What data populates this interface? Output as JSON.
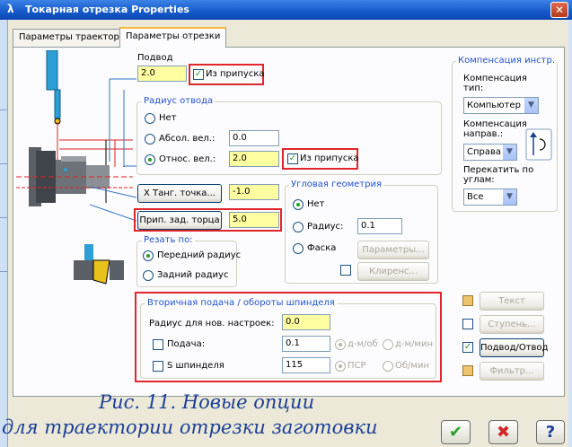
{
  "window": {
    "title": "Токарная отрезка Properties",
    "title_icon": "lambda-icon",
    "close_glyph": "✕"
  },
  "tabs": [
    {
      "label": "Параметры траектории",
      "active": false
    },
    {
      "label": "Параметры отрезки",
      "active": true
    }
  ],
  "approach": {
    "label": "Подвод",
    "value": "2.0",
    "from_stock_label": "Из припуска",
    "from_stock_checked": true
  },
  "retract": {
    "group_label": "Радиус отвода",
    "options": [
      "Нет",
      "Абсол. вел.:",
      "Относ. вел.:"
    ],
    "selected_index": 2,
    "abs_value": "0.0",
    "rel_value": "2.0",
    "from_stock_label": "Из припуска",
    "from_stock_checked": true
  },
  "x_tangent": {
    "button_label": "X Танг. точка...",
    "value": "-1.0"
  },
  "back_face": {
    "button_label": "Прип. зад. торца",
    "value": "5.0"
  },
  "cut_by": {
    "group_label": "Резать по:",
    "options": [
      "Передний радиус",
      "Задний радиус"
    ],
    "selected_index": 0
  },
  "angular": {
    "group_label": "Угловая геометрия",
    "options": [
      "Нет",
      "Радиус:",
      "Фаска"
    ],
    "selected_index": 0,
    "radius_value": "0.1",
    "params_button": "Параметры...",
    "clearance_button": "Клиренс..."
  },
  "comp": {
    "group_label": "Компенсация инстр.",
    "type_label": "Компенсация тип:",
    "type_value": "Компьютер",
    "dir_label": "Компенсация направ.:",
    "dir_value": "Справа",
    "roll_label": "Перекатить по углам:",
    "roll_value": "Все"
  },
  "secondary": {
    "group_label": "Вторичная подача / обороты шпинделя",
    "radius_label": "Радиус для нов. настроек:",
    "radius_value": "0.0",
    "feed_label": "Подача:",
    "feed_value": "0.1",
    "feed_units": [
      "д-м/об",
      "д-м/мин"
    ],
    "spindle_label": "S шпинделя",
    "spindle_value": "115",
    "spindle_units": [
      "ПСР",
      "Об/мин"
    ]
  },
  "right_buttons": [
    {
      "label": "Текст",
      "enabled": false,
      "check": "orange"
    },
    {
      "label": "Ступень...",
      "enabled": false,
      "check": "empty"
    },
    {
      "label": "Подвод/Отвод",
      "enabled": true,
      "check": "checked"
    },
    {
      "label": "Фильтр...",
      "enabled": false,
      "check": "orange"
    }
  ],
  "caption": {
    "line1": "Рис. 11. Новые опции",
    "line2": "для траектории отрезки заготовки"
  },
  "footer": {
    "ok_glyph": "✔",
    "cancel_glyph": "✖",
    "help_glyph": "?"
  },
  "colors": {
    "accent_red": "#e0252b",
    "input_yellow": "#ffffa2",
    "group_label_blue": "#2152cd",
    "caption_blue": "#1b3f96",
    "title_blue": "#1458c9"
  }
}
